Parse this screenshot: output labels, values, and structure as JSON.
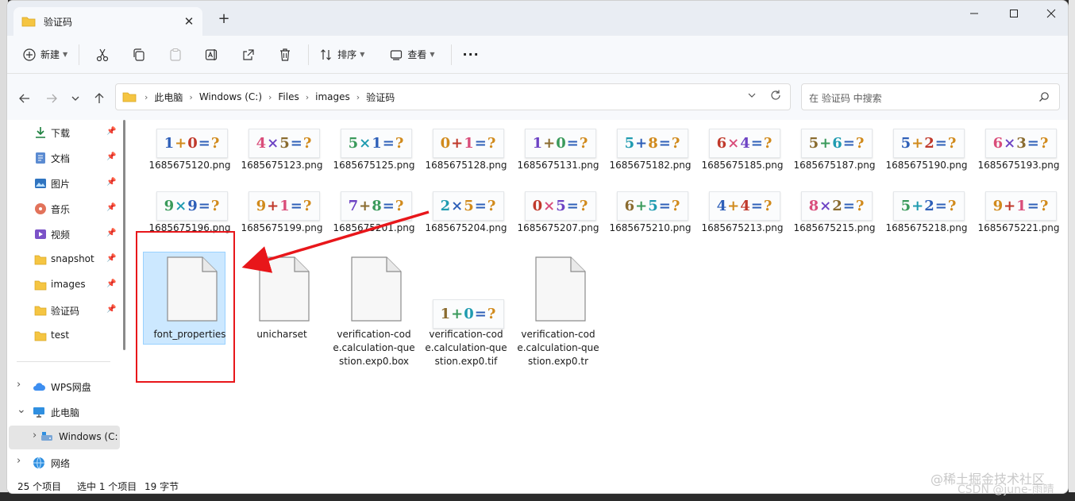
{
  "window": {
    "tab_title": "验证码",
    "new_tab_symbol": "+",
    "close_tab_symbol": "✕"
  },
  "toolbar": {
    "new_label": "新建",
    "sort_label": "排序",
    "view_label": "查看",
    "more_label": "···"
  },
  "address": {
    "crumbs": [
      "此电脑",
      "Windows (C:)",
      "Files",
      "images",
      "验证码"
    ]
  },
  "search": {
    "placeholder": "在 验证码 中搜索"
  },
  "sidebar": {
    "items": [
      {
        "label": "下载",
        "icon": "download-icon",
        "pinned": true
      },
      {
        "label": "文档",
        "icon": "document-icon",
        "pinned": true
      },
      {
        "label": "图片",
        "icon": "pictures-icon",
        "pinned": true
      },
      {
        "label": "音乐",
        "icon": "music-icon",
        "pinned": true
      },
      {
        "label": "视频",
        "icon": "video-icon",
        "pinned": true
      },
      {
        "label": "snapshot",
        "icon": "folder-icon",
        "pinned": true
      },
      {
        "label": "images",
        "icon": "folder-icon",
        "pinned": true
      },
      {
        "label": "验证码",
        "icon": "folder-icon",
        "pinned": true
      },
      {
        "label": "test",
        "icon": "folder-icon",
        "pinned": false
      },
      {
        "label": "WPS网盘",
        "icon": "cloud-icon"
      },
      {
        "label": "此电脑",
        "icon": "computer-icon"
      },
      {
        "label": "Windows (C:",
        "icon": "drive-icon"
      },
      {
        "label": "网络",
        "icon": "network-icon"
      }
    ]
  },
  "files": [
    {
      "name": "1685675120.png",
      "captcha": "1+0=?"
    },
    {
      "name": "1685675123.png",
      "captcha": "4×5=?"
    },
    {
      "name": "1685675125.png",
      "captcha": "5×1=?"
    },
    {
      "name": "1685675128.png",
      "captcha": "0+1=?"
    },
    {
      "name": "1685675131.png",
      "captcha": "1+0=?"
    },
    {
      "name": "1685675182.png",
      "captcha": "5+8=?"
    },
    {
      "name": "1685675185.png",
      "captcha": "6×4=?"
    },
    {
      "name": "1685675187.png",
      "captcha": "5+6=?"
    },
    {
      "name": "1685675190.png",
      "captcha": "5+2=?"
    },
    {
      "name": "1685675193.png",
      "captcha": "6×3=?"
    },
    {
      "name": "1685675196.png",
      "captcha": "9×9=?"
    },
    {
      "name": "1685675199.png",
      "captcha": "9+1=?"
    },
    {
      "name": "1685675201.png",
      "captcha": "7+8=?"
    },
    {
      "name": "1685675204.png",
      "captcha": "2×5=?"
    },
    {
      "name": "1685675207.png",
      "captcha": "0×5=?"
    },
    {
      "name": "1685675210.png",
      "captcha": "6+5=?"
    },
    {
      "name": "1685675213.png",
      "captcha": "4+4=?"
    },
    {
      "name": "1685675215.png",
      "captcha": "8×2=?"
    },
    {
      "name": "1685675218.png",
      "captcha": "5+2=?"
    },
    {
      "name": "1685675221.png",
      "captcha": "9+1=?"
    },
    {
      "name": "font_properties",
      "type": "file"
    },
    {
      "name": "unicharset",
      "type": "file"
    },
    {
      "name": "verification-code.calculation-question.exp0.box",
      "type": "file"
    },
    {
      "name": "verification-code.calculation-question.exp0.tif",
      "captcha": "1+0=?"
    },
    {
      "name": "verification-code.calculation-question.exp0.tr",
      "type": "file"
    }
  ],
  "status": {
    "count": "25 个项目",
    "selected": "选中 1 个项目",
    "size": "19 字节"
  },
  "watermark": {
    "line1": "@稀土掘金技术社区",
    "line2": "CSDN @june-雨晴"
  },
  "colors": {
    "annotation": "#e8161a",
    "selection": "#cce8ff",
    "folder": "#f5c542",
    "accent": "#0067c0"
  }
}
